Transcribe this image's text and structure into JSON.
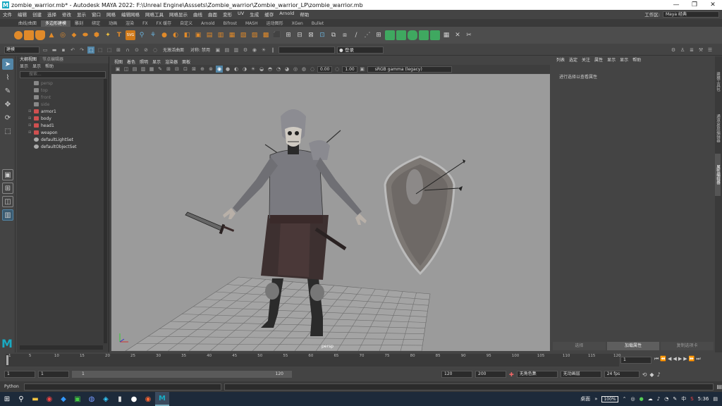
{
  "titlebar": {
    "title": "zombie_warrior.mb* - Autodesk MAYA 2022: F:\\Unreal Engine\\Asssets\\Zombie_warrior\\Zombie_warrior_LP\\zombie_warrior.mb",
    "minimize": "—",
    "maximize": "❐",
    "close": "✕"
  },
  "menu": {
    "items": [
      "文件",
      "编辑",
      "创建",
      "选择",
      "修改",
      "显示",
      "窗口",
      "网格",
      "编辑网格",
      "网格工具",
      "网格显示",
      "曲线",
      "曲面",
      "变形",
      "UV",
      "生成",
      "缓存",
      "Arnold",
      "帮助"
    ],
    "workspace_label": "工作区:",
    "workspace_value": "Maya 经典"
  },
  "shelf_tabs": {
    "items": [
      "曲线/曲面",
      "多边形建模",
      "雕刻",
      "绑定",
      "动画",
      "渲染",
      "FX",
      "FX 缓存",
      "自定义",
      "Arnold",
      "Bifrost",
      "MASH",
      "运动图形",
      "XGen",
      "Bullet"
    ],
    "active_index": 1
  },
  "status_line": {
    "mode": "建模",
    "constraint_label": "无激活曲面",
    "symmetry_label": "对称: 禁用",
    "login_label": "登录"
  },
  "outliner": {
    "tabs": [
      "大纲视图",
      "节点编辑器"
    ],
    "menu": [
      "显示",
      "显示",
      "帮助"
    ],
    "search_placeholder": "搜索...",
    "rows": [
      {
        "label": "persp",
        "dim": true,
        "expand": false
      },
      {
        "label": "top",
        "dim": true,
        "expand": false
      },
      {
        "label": "front",
        "dim": true,
        "expand": false
      },
      {
        "label": "side",
        "dim": true,
        "expand": false
      },
      {
        "label": "armor1",
        "dim": false,
        "expand": true
      },
      {
        "label": "body",
        "dim": false,
        "expand": true
      },
      {
        "label": "head1",
        "dim": false,
        "expand": true
      },
      {
        "label": "weapon",
        "dim": false,
        "expand": true
      },
      {
        "label": "defaultLightSet",
        "dim": false,
        "expand": false
      },
      {
        "label": "defaultObjectSet",
        "dim": false,
        "expand": false
      }
    ]
  },
  "viewport": {
    "menu": [
      "视图",
      "着色",
      "照明",
      "显示",
      "渲染器",
      "面板"
    ],
    "exposure": "0.00",
    "gamma": "1.00",
    "color_space": "sRGB gamma (legacy)",
    "camera_label": "persp"
  },
  "attribute_editor": {
    "menu": [
      "列表",
      "选定",
      "关注",
      "属性",
      "显示",
      "显示",
      "帮助"
    ],
    "hint": "进行选择以查看属性",
    "footer": [
      "选择",
      "加载属性",
      "复制选项卡"
    ],
    "footer_active": 1,
    "side_tabs": [
      "建模工具包",
      "通道盒/层编辑器",
      "属性编辑器"
    ]
  },
  "timeslider": {
    "ticks": [
      "1",
      "5",
      "10",
      "15",
      "20",
      "25",
      "30",
      "35",
      "40",
      "45",
      "50",
      "55",
      "60",
      "65",
      "70",
      "75",
      "80",
      "85",
      "90",
      "95",
      "100",
      "105",
      "110",
      "115",
      "120"
    ],
    "current_frame": "1"
  },
  "range": {
    "start": "1",
    "playback_start": "1",
    "range_start": "1",
    "range_end": "120",
    "playback_end": "120",
    "end": "200",
    "character_set": "无角色集",
    "anim_layer": "无动画层",
    "fps": "24 fps"
  },
  "cmdline": {
    "label": "Python"
  },
  "taskbar": {
    "keyboard": "桌面",
    "battery": "100%",
    "ime": "中",
    "time": "5:36"
  },
  "colors": {
    "accent": "#5285a6",
    "viewport_bg": "#9b9b9b",
    "maya_teal": "#1aa9c1"
  }
}
